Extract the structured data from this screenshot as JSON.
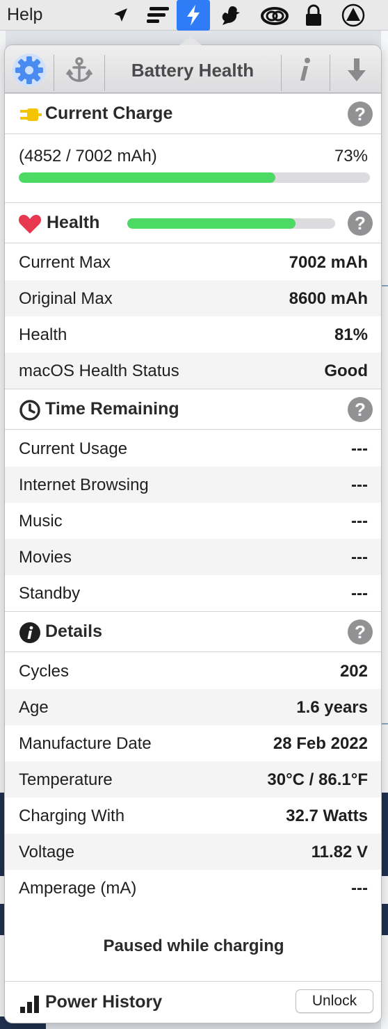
{
  "menubar": {
    "help_label": "Help",
    "icons": [
      "location-arrow-icon",
      "lines-icon",
      "bolt-icon",
      "bird-icon",
      "creative-cloud-icon",
      "lock-icon",
      "triangle-circle-icon"
    ]
  },
  "toolbar": {
    "title": "Battery Health"
  },
  "current_charge": {
    "title": "Current Charge",
    "mah_text": "(4852 / 7002 mAh)",
    "percent_text": "73%",
    "fraction": 0.73
  },
  "health": {
    "title": "Health",
    "fraction": 0.81,
    "rows": [
      {
        "label": "Current Max",
        "value": "7002 mAh"
      },
      {
        "label": "Original Max",
        "value": "8600 mAh"
      },
      {
        "label": "Health",
        "value": "81%"
      },
      {
        "label": "macOS Health Status",
        "value": "Good"
      }
    ]
  },
  "time_remaining": {
    "title": "Time Remaining",
    "rows": [
      {
        "label": "Current Usage",
        "value": "---"
      },
      {
        "label": "Internet Browsing",
        "value": "---"
      },
      {
        "label": "Music",
        "value": "---"
      },
      {
        "label": "Movies",
        "value": "---"
      },
      {
        "label": "Standby",
        "value": "---"
      }
    ]
  },
  "details": {
    "title": "Details",
    "rows": [
      {
        "label": "Cycles",
        "value": "202"
      },
      {
        "label": "Age",
        "value": "1.6 years"
      },
      {
        "label": "Manufacture Date",
        "value": "28 Feb 2022"
      },
      {
        "label": "Temperature",
        "value": "30°C / 86.1°F"
      },
      {
        "label": "Charging With",
        "value": "32.7 Watts"
      },
      {
        "label": "Voltage",
        "value": "11.82 V"
      },
      {
        "label": "Amperage (mA)",
        "value": "---"
      }
    ]
  },
  "status_text": "Paused while charging",
  "power_history": {
    "title": "Power History",
    "unlock_label": "Unlock"
  },
  "help_glyph": "?",
  "colors": {
    "accent_blue": "#2f7cf6",
    "progress_green": "#4cd964",
    "heart_red": "#e8384f",
    "plug_yellow": "#f5c400"
  }
}
